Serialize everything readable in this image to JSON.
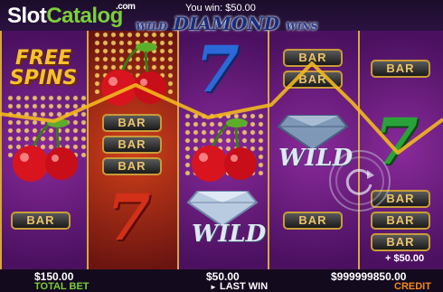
{
  "header": {
    "logo_slot": "Slot",
    "logo_catalog": "Catalog",
    "logo_com": ".com",
    "game_title_wild": "WILD",
    "game_title_diamond": "DIAMOND",
    "game_title_wins": "WINS",
    "you_win": "You win: $50.00"
  },
  "reels": {
    "bar_label": "BAR",
    "wild_label": "WILD",
    "seven_label": "7",
    "free_spins_line1": "FREE",
    "free_spins_line2": "SPINS",
    "line_win": "+ $50.00"
  },
  "footer": {
    "total_bet_value": "$150.00",
    "total_bet_label": "TOTAL BET",
    "last_win_value": "$50.00",
    "last_win_label": "LAST WIN",
    "credit_value": "$999999850.00",
    "credit_label": "CREDIT"
  },
  "colors": {
    "accent_gold": "#d7a83a",
    "total_bet_label_color": "#7bcf3a",
    "credit_label_color": "#f28c1a",
    "win_line": "#f2b81e"
  }
}
